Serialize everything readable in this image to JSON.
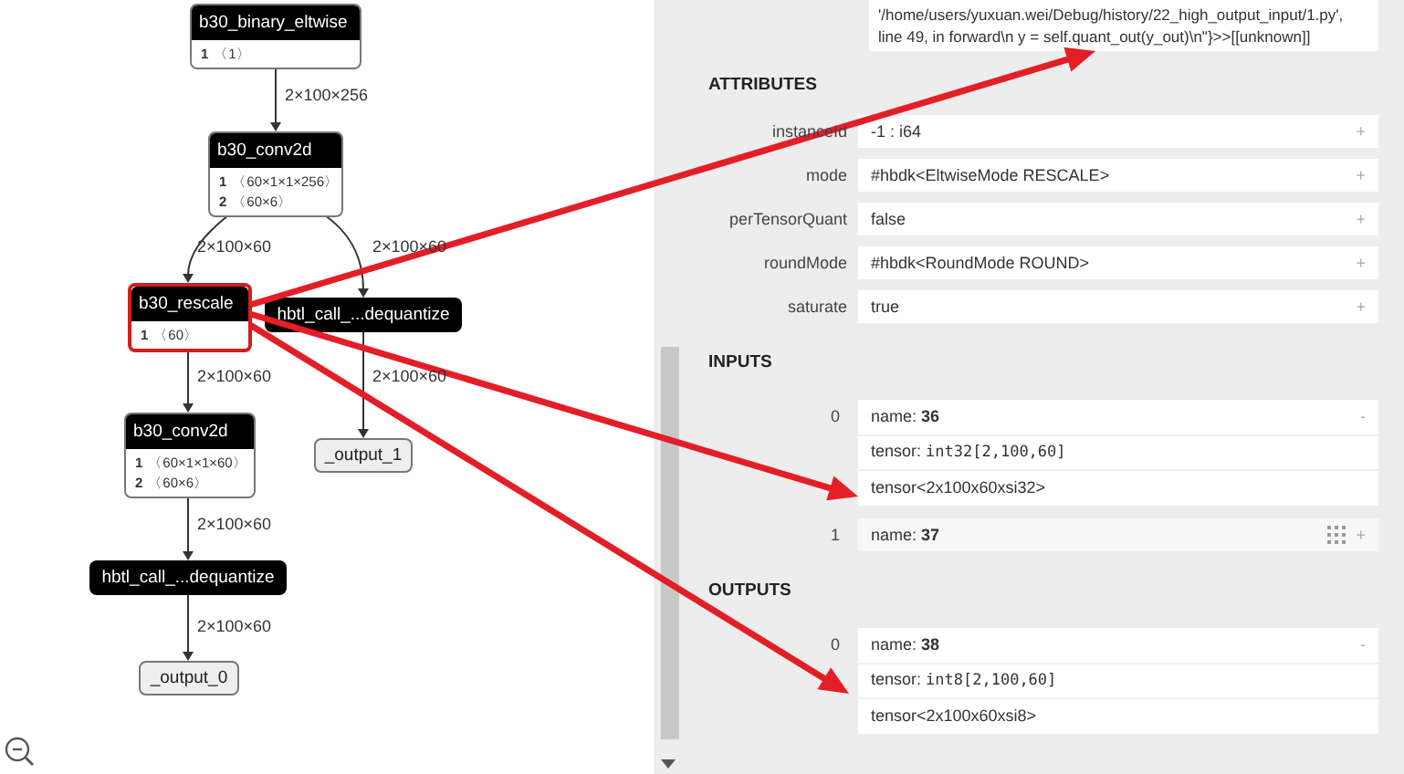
{
  "graph": {
    "nodes": [
      {
        "kind": "op",
        "title": "b30_binary_eltwise",
        "selected": false,
        "params": [
          {
            "index": "1",
            "shape": "〈1〉"
          }
        ]
      },
      {
        "kind": "op",
        "title": "b30_conv2d",
        "selected": false,
        "params": [
          {
            "index": "1",
            "shape": "〈60×1×1×256〉"
          },
          {
            "index": "2",
            "shape": "〈60×6〉"
          }
        ]
      },
      {
        "kind": "op",
        "title": "b30_rescale",
        "selected": true,
        "params": [
          {
            "index": "1",
            "shape": "〈60〉"
          }
        ]
      },
      {
        "kind": "call",
        "title": "hbtl_call_...dequantize",
        "selected": false
      },
      {
        "kind": "op",
        "title": "b30_conv2d",
        "selected": false,
        "params": [
          {
            "index": "1",
            "shape": "〈60×1×1×60〉"
          },
          {
            "index": "2",
            "shape": "〈60×6〉"
          }
        ]
      },
      {
        "kind": "output",
        "title": "_output_1",
        "selected": false
      },
      {
        "kind": "call",
        "title": "hbtl_call_...dequantize",
        "selected": false
      },
      {
        "kind": "output",
        "title": "_output_0",
        "selected": false
      }
    ],
    "edges": [
      {
        "label": "2×100×256"
      },
      {
        "label": "2×100×60"
      },
      {
        "label": "2×100×60"
      },
      {
        "label": "2×100×60"
      },
      {
        "label": "2×100×60"
      },
      {
        "label": "2×100×60"
      },
      {
        "label": "2×100×60"
      }
    ]
  },
  "panel": {
    "description": [
      "'/home/users/yuxuan.wei/Debug/history/22_high_output_input/1.py',",
      "line 49, in forward\\n y = self.quant_out(y_out)\\n\"}>>[[unknown]]"
    ],
    "attributes": {
      "title": "ATTRIBUTES",
      "items": [
        {
          "name": "instanceId",
          "value": "-1 : i64",
          "toggle": "+"
        },
        {
          "name": "mode",
          "value": "#hbdk<EltwiseMode RESCALE>",
          "toggle": "+"
        },
        {
          "name": "perTensorQuant",
          "value": "false",
          "toggle": "+"
        },
        {
          "name": "roundMode",
          "value": "#hbdk<RoundMode ROUND>",
          "toggle": "+"
        },
        {
          "name": "saturate",
          "value": "true",
          "toggle": "+"
        }
      ]
    },
    "inputs": {
      "title": "INPUTS",
      "items": [
        {
          "index": "0",
          "expanded": true,
          "toggle": "-",
          "name_label": "name:",
          "name": "36",
          "type_label": "tensor:",
          "type": "int32[2,100,60]",
          "detail": "tensor<2x100x60xsi32>"
        },
        {
          "index": "1",
          "expanded": false,
          "toggle": "+",
          "name_label": "name:",
          "name": "37"
        }
      ]
    },
    "outputs": {
      "title": "OUTPUTS",
      "items": [
        {
          "index": "0",
          "expanded": true,
          "toggle": "-",
          "name_label": "name:",
          "name": "38",
          "type_label": "tensor:",
          "type": "int8[2,100,60]",
          "detail": "tensor<2x100x60xsi8>"
        }
      ]
    }
  }
}
